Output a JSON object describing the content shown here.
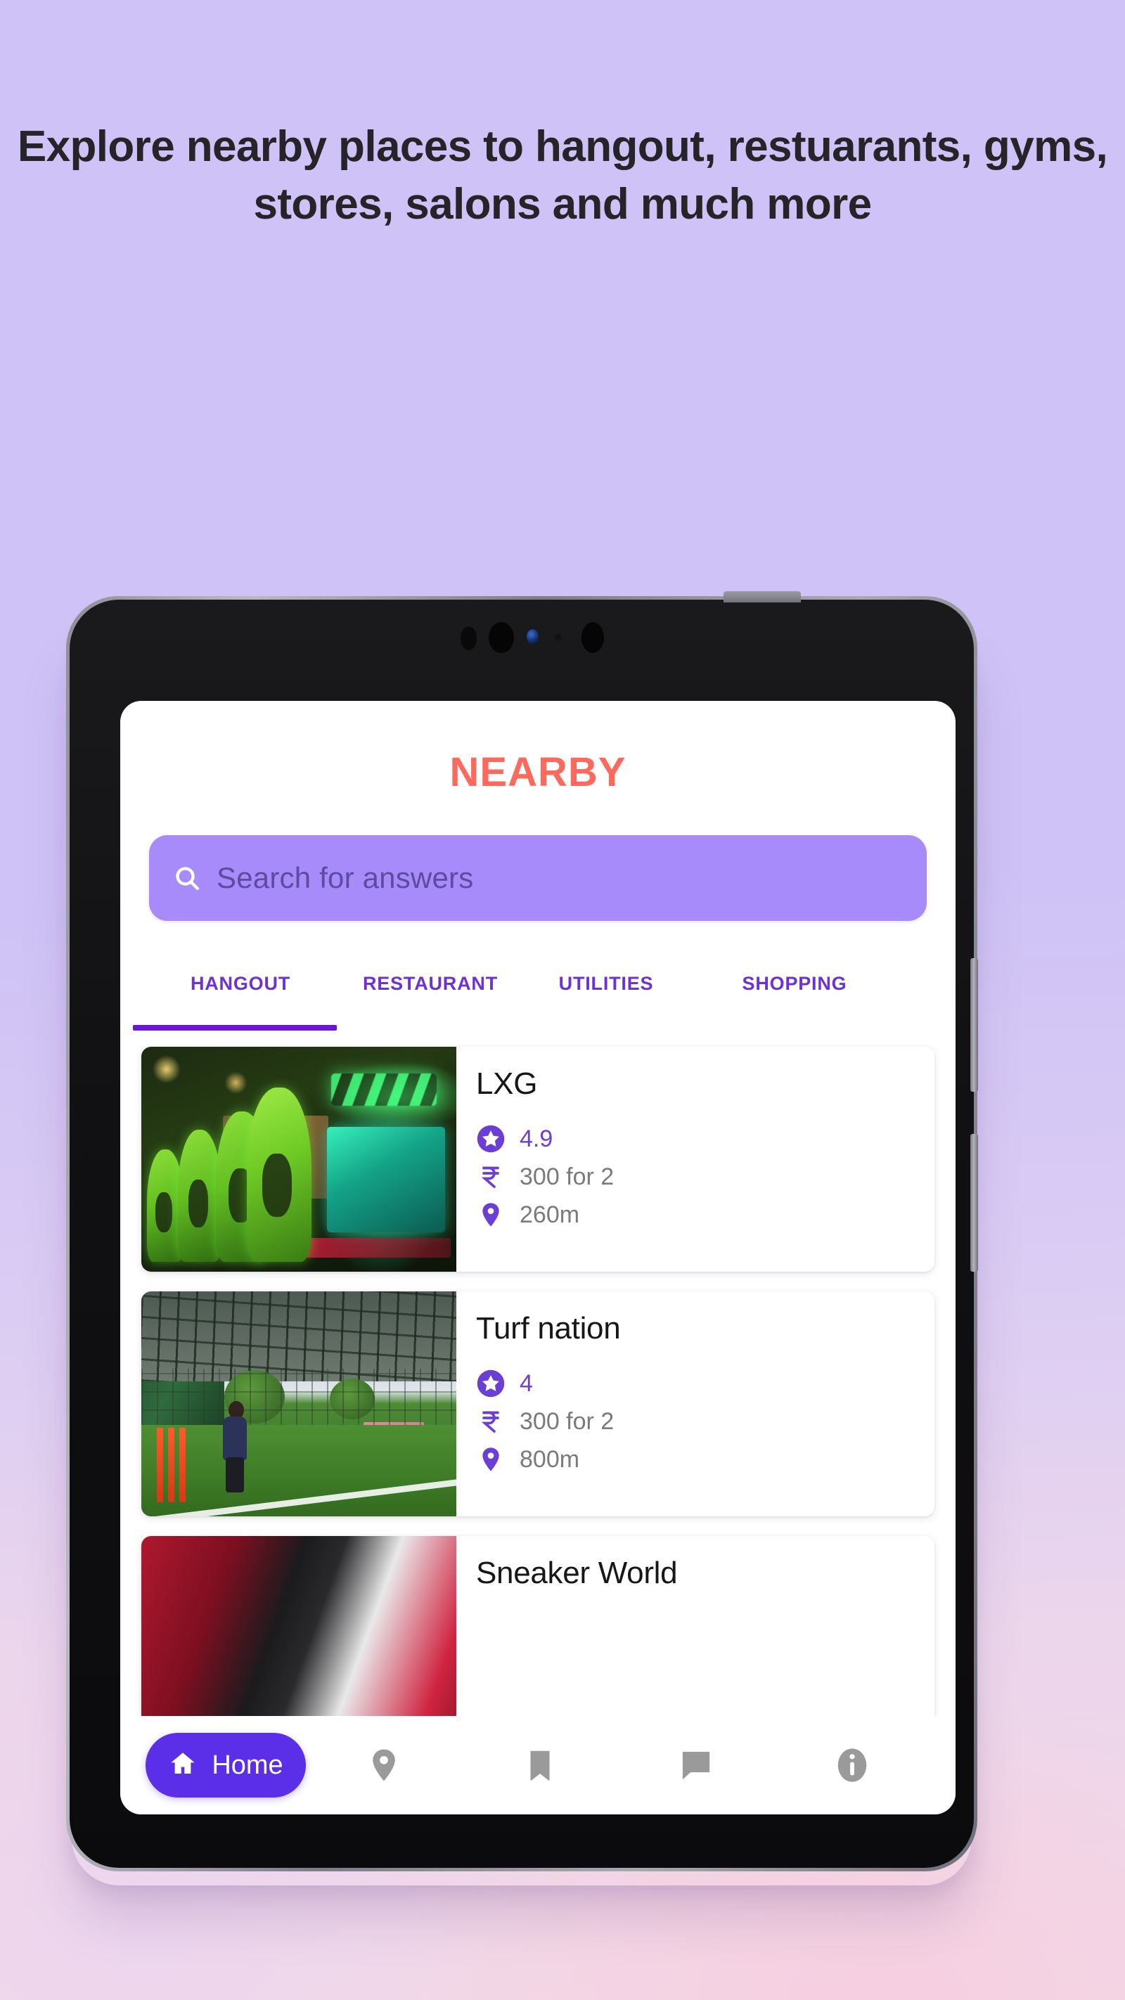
{
  "promo": {
    "headline": "Explore nearby places to hangout, restuarants, gyms, stores, salons and much more"
  },
  "app": {
    "title": "NEARBY",
    "brand_color": "#fc6a5d",
    "accent_color": "#6d13e0",
    "search": {
      "placeholder": "Search for answers",
      "value": "",
      "icon": "search-icon",
      "background": "#a78bfa"
    },
    "tabs": [
      {
        "label": "HANGOUT",
        "active": true
      },
      {
        "label": "RESTAURANT",
        "active": false
      },
      {
        "label": "UTILITIES",
        "active": false
      },
      {
        "label": "SHOPPING",
        "active": false
      }
    ],
    "places": [
      {
        "name": "LXG",
        "rating": "4.9",
        "price": "300 for 2",
        "distance": "260m",
        "rating_icon": "star-badge-icon",
        "price_icon": "rupee-icon",
        "distance_icon": "map-pin-icon",
        "thumbnail": "gaming-cafe-thumbnail"
      },
      {
        "name": "Turf nation",
        "rating": "4",
        "price": "300 for 2",
        "distance": "800m",
        "rating_icon": "star-badge-icon",
        "price_icon": "rupee-icon",
        "distance_icon": "map-pin-icon",
        "thumbnail": "turf-ground-thumbnail"
      },
      {
        "name": "Sneaker World",
        "rating": "",
        "price": "",
        "distance": "",
        "rating_icon": "star-badge-icon",
        "price_icon": "rupee-icon",
        "distance_icon": "map-pin-icon",
        "thumbnail": "sneaker-store-thumbnail"
      }
    ],
    "bottom_nav": {
      "home_label": "Home",
      "home_icon": "home-icon",
      "home_color": "#5b2fe8",
      "items": [
        {
          "icon": "map-pin-icon",
          "active": false
        },
        {
          "icon": "bookmark-icon",
          "active": false
        },
        {
          "icon": "chat-icon",
          "active": false
        },
        {
          "icon": "info-icon",
          "active": false
        }
      ]
    }
  }
}
